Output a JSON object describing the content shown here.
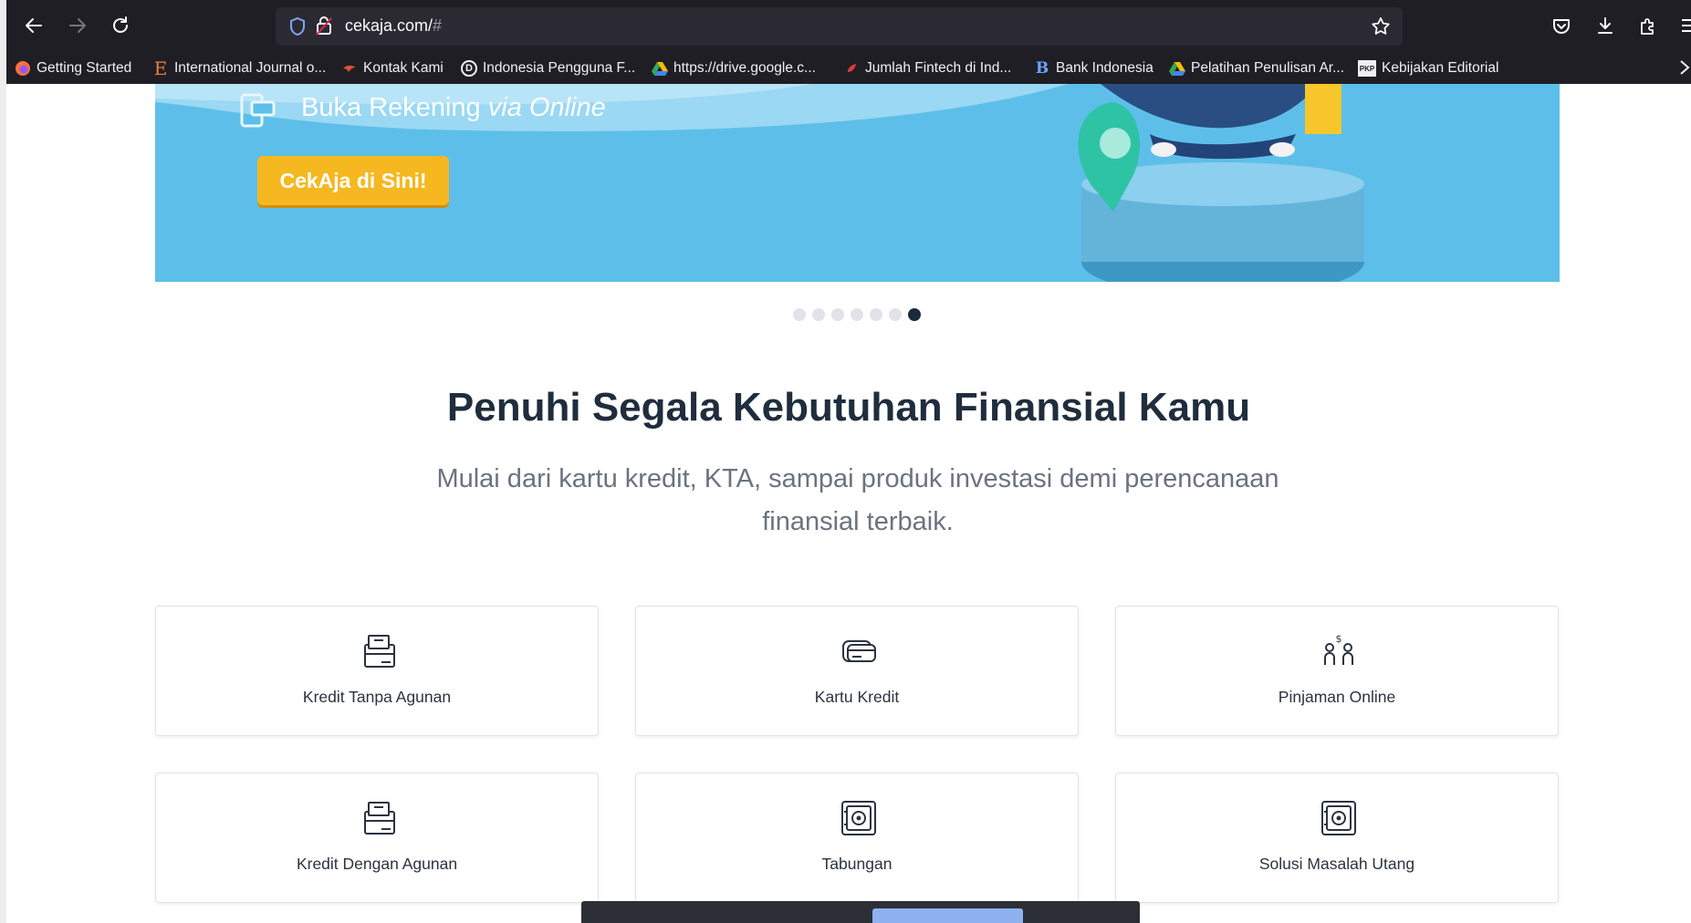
{
  "browser": {
    "url_host": "cekaja.com/",
    "url_hash": "#",
    "bookmarks": [
      {
        "label": "Getting Started",
        "icon": "firefox-icon"
      },
      {
        "label": "International Journal o...",
        "icon": "journal-e-icon"
      },
      {
        "label": "Kontak Kami",
        "icon": "bird-icon"
      },
      {
        "label": "Indonesia Pengguna F...",
        "icon": "d-logo-icon"
      },
      {
        "label": "https://drive.google.c...",
        "icon": "google-drive-icon"
      },
      {
        "label": "Jumlah Fintech di Ind...",
        "icon": "red-leaf-icon"
      },
      {
        "label": "Bank Indonesia",
        "icon": "bank-indonesia-icon"
      },
      {
        "label": "Pelatihan Penulisan Ar...",
        "icon": "google-drive-icon"
      },
      {
        "label": "Kebijakan Editorial",
        "icon": "pkp-logo-icon"
      }
    ]
  },
  "hero": {
    "text_prefix": "Buka Rekening ",
    "text_italic": "via Online",
    "cta_label": "CekAja di Sini!",
    "slides_total": 7,
    "active_slide": 7
  },
  "section": {
    "title": "Penuhi Segala Kebutuhan Finansial Kamu",
    "subtitle_line1": "Mulai dari kartu kredit, KTA, sampai produk investasi demi perencanaan",
    "subtitle_line2": "finansial terbaik."
  },
  "products": [
    {
      "label": "Kredit Tanpa Agunan",
      "icon": "wallet-icon"
    },
    {
      "label": "Kartu Kredit",
      "icon": "credit-card-icon"
    },
    {
      "label": "Pinjaman Online",
      "icon": "people-money-icon"
    },
    {
      "label": "Kredit Dengan Agunan",
      "icon": "wallet-icon"
    },
    {
      "label": "Tabungan",
      "icon": "safe-icon"
    },
    {
      "label": "Solusi Masalah Utang",
      "icon": "safe-icon"
    }
  ],
  "colors": {
    "browser_chrome": "#1f1e25",
    "hero_blue": "#5bbde8",
    "cta_yellow": "#f5b820",
    "heading_text": "#1f2d3d",
    "active_dot": "#1c2a3d"
  }
}
